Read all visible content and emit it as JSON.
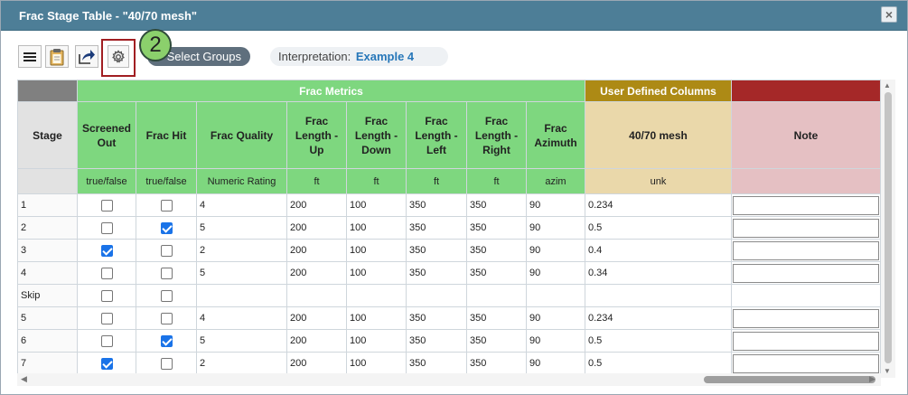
{
  "window": {
    "title": "Frac Stage Table - \"40/70 mesh\"",
    "close_icon": "×"
  },
  "toolbar": {
    "select_groups_label": "Select Groups",
    "badge": "2",
    "interpretation_label": "Interpretation:",
    "interpretation_value": "Example 4"
  },
  "groups": {
    "frac_metrics": "Frac Metrics",
    "user_defined": "User Defined Columns"
  },
  "columns": [
    {
      "header": "Stage",
      "unit": ""
    },
    {
      "header": "Screened Out",
      "unit": "true/false"
    },
    {
      "header": "Frac Hit",
      "unit": "true/false"
    },
    {
      "header": "Frac Quality",
      "unit": "Numeric Rating"
    },
    {
      "header": "Frac Length - Up",
      "unit": "ft"
    },
    {
      "header": "Frac Length - Down",
      "unit": "ft"
    },
    {
      "header": "Frac Length - Left",
      "unit": "ft"
    },
    {
      "header": "Frac Length - Right",
      "unit": "ft"
    },
    {
      "header": "Frac Azimuth",
      "unit": "azim"
    },
    {
      "header": "40/70 mesh",
      "unit": "unk"
    },
    {
      "header": "Note",
      "unit": ""
    }
  ],
  "rows": [
    {
      "stage": "1",
      "screened": false,
      "hit": false,
      "quality": "4",
      "up": "200",
      "down": "100",
      "left": "350",
      "right": "350",
      "azimuth": "90",
      "mesh": "0.234",
      "note": ""
    },
    {
      "stage": "2",
      "screened": false,
      "hit": true,
      "quality": "5",
      "up": "200",
      "down": "100",
      "left": "350",
      "right": "350",
      "azimuth": "90",
      "mesh": "0.5",
      "note": ""
    },
    {
      "stage": "3",
      "screened": true,
      "hit": false,
      "quality": "2",
      "up": "200",
      "down": "100",
      "left": "350",
      "right": "350",
      "azimuth": "90",
      "mesh": "0.4",
      "note": ""
    },
    {
      "stage": "4",
      "screened": false,
      "hit": false,
      "quality": "5",
      "up": "200",
      "down": "100",
      "left": "350",
      "right": "350",
      "azimuth": "90",
      "mesh": "0.34",
      "note": ""
    },
    {
      "stage": "Skip",
      "screened": false,
      "hit": false,
      "quality": "",
      "up": "",
      "down": "",
      "left": "",
      "right": "",
      "azimuth": "",
      "mesh": "",
      "note": null
    },
    {
      "stage": "5",
      "screened": false,
      "hit": false,
      "quality": "4",
      "up": "200",
      "down": "100",
      "left": "350",
      "right": "350",
      "azimuth": "90",
      "mesh": "0.234",
      "note": ""
    },
    {
      "stage": "6",
      "screened": false,
      "hit": true,
      "quality": "5",
      "up": "200",
      "down": "100",
      "left": "350",
      "right": "350",
      "azimuth": "90",
      "mesh": "0.5",
      "note": ""
    },
    {
      "stage": "7",
      "screened": true,
      "hit": false,
      "quality": "2",
      "up": "200",
      "down": "100",
      "left": "350",
      "right": "350",
      "azimuth": "90",
      "mesh": "0.5",
      "note": ""
    }
  ],
  "icons": {
    "menu": "hamburger-menu-icon",
    "clipboard": "clipboard-icon",
    "export": "export-arrow-icon",
    "settings": "gear-icon"
  },
  "colors": {
    "titlebar": "#4d7e97",
    "frac_metrics": "#7ed77f",
    "user_defined": "#ad8a15",
    "note": "#a52828",
    "checkbox_on": "#1a73e8",
    "callout_border": "#a11e22",
    "badge": "#8bd06c"
  }
}
